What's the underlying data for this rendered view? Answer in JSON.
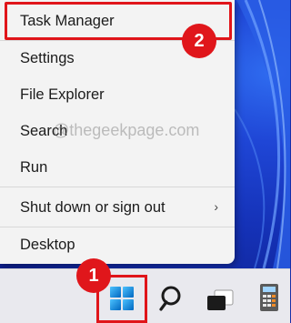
{
  "menu": {
    "items": [
      {
        "label": "Task Manager"
      },
      {
        "label": "Settings"
      },
      {
        "label": "File Explorer"
      },
      {
        "label": "Search"
      },
      {
        "label": "Run"
      },
      {
        "label": "Shut down or sign out",
        "has_submenu": true
      },
      {
        "label": "Desktop"
      }
    ]
  },
  "annotations": {
    "badge_1": "1",
    "badge_2": "2",
    "highlight_color": "#e0151a"
  },
  "watermark": "@thegeekpage.com",
  "taskbar": {
    "icons": [
      "windows-start-icon",
      "search-icon",
      "task-view-icon",
      "calculator-icon"
    ]
  },
  "colors": {
    "menu_bg": "#f3f3f3",
    "taskbar_bg": "#e9e9ee",
    "accent_blue": "#0067c0",
    "annotation_red": "#e0151a"
  }
}
